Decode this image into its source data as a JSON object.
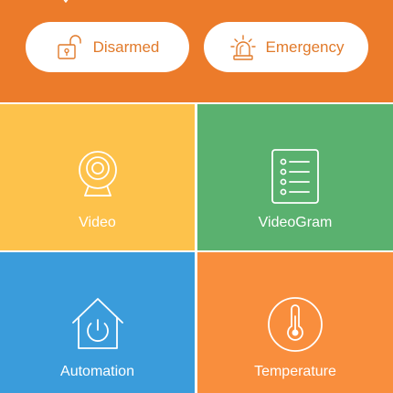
{
  "header": {
    "background_color": "#ec7b2a",
    "collapse_icon": "chevron-down-icon",
    "buttons": [
      {
        "label": "Disarmed",
        "icon": "unlocked-padlock-icon",
        "text_color": "#e17a2a"
      },
      {
        "label": "Emergency",
        "icon": "siren-icon",
        "text_color": "#e17a2a"
      }
    ]
  },
  "tiles": [
    {
      "label": "Video",
      "icon": "camera-icon",
      "color": "#fdc24b"
    },
    {
      "label": "VideoGram",
      "icon": "list-document-icon",
      "color": "#5ab16f"
    },
    {
      "label": "Automation",
      "icon": "house-power-icon",
      "color": "#3a9cdb"
    },
    {
      "label": "Temperature",
      "icon": "thermometer-icon",
      "color": "#f98e3d"
    }
  ]
}
